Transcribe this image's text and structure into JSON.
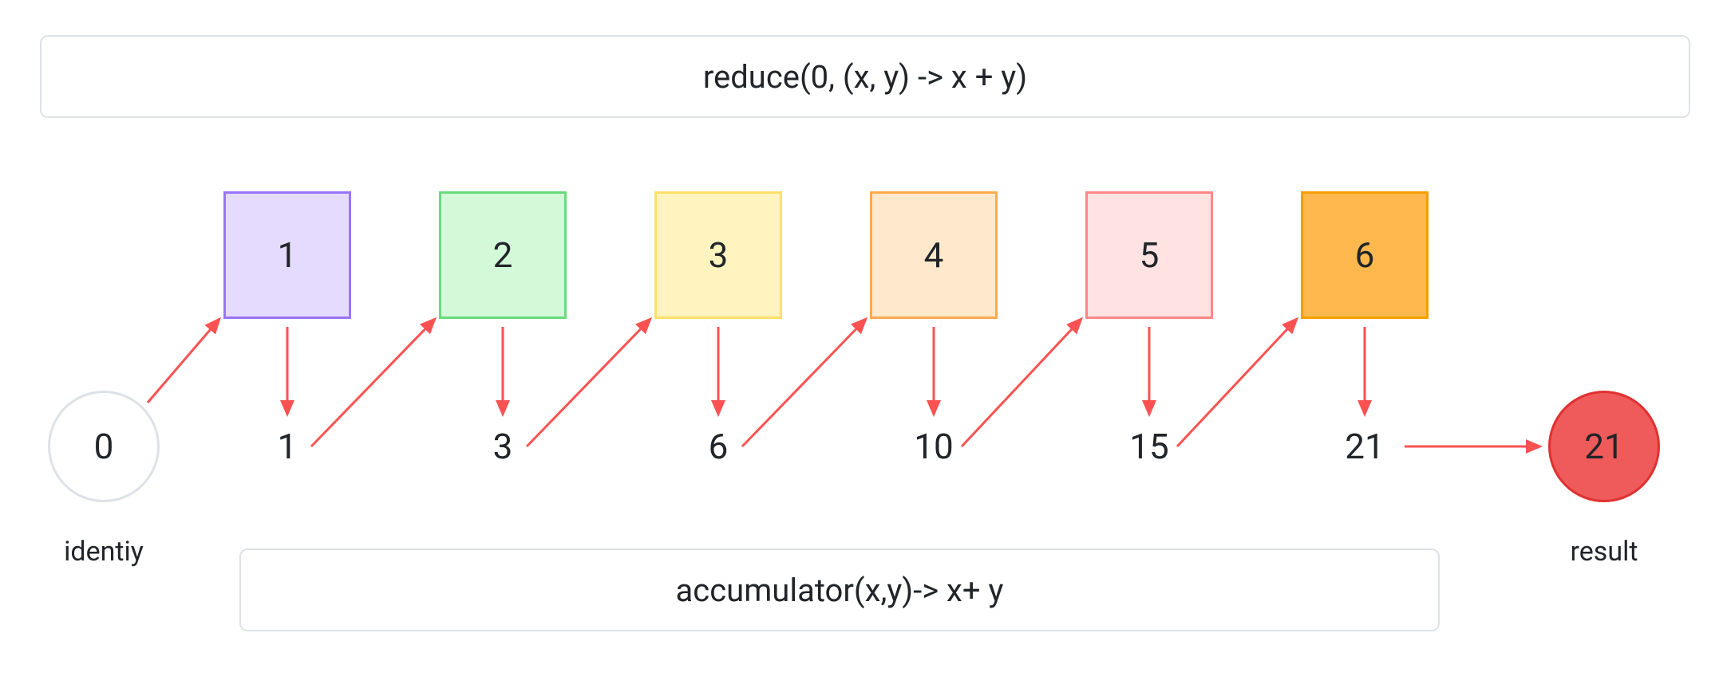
{
  "chart_data": {
    "type": "diagram",
    "operation": "reduce",
    "identity": 0,
    "inputs": [
      1,
      2,
      3,
      4,
      5,
      6
    ],
    "accumulations": [
      1,
      3,
      6,
      10,
      15,
      21
    ],
    "result": 21,
    "reduce_expr": "reduce(0, (x, y) -> x + y)",
    "accumulator_expr": "accumulator(x,y)-> x+ y"
  },
  "top_box_label": "reduce(0, (x, y) -> x + y)",
  "bottom_box_label": "accumulator(x,y)-> x+ y",
  "identity": {
    "value": "0",
    "caption": "identiy"
  },
  "result": {
    "value": "21",
    "caption": "result"
  },
  "squares": [
    {
      "value": "1",
      "fill": "#e5dbff",
      "stroke": "#9775fa"
    },
    {
      "value": "2",
      "fill": "#d3f9d8",
      "stroke": "#69db7c"
    },
    {
      "value": "3",
      "fill": "#fff3bf",
      "stroke": "#ffe066"
    },
    {
      "value": "4",
      "fill": "#ffe8cc",
      "stroke": "#ffa94d"
    },
    {
      "value": "5",
      "fill": "#ffe3e3",
      "stroke": "#ff8787"
    },
    {
      "value": "6",
      "fill": "#ffb84d",
      "stroke": "#f59f00"
    }
  ],
  "accumulations": [
    "1",
    "3",
    "6",
    "10",
    "15",
    "21"
  ],
  "arrow_color": "#fa5252"
}
